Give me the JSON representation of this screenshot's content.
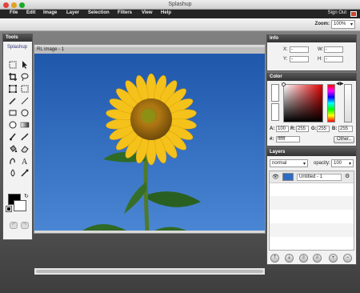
{
  "window": {
    "title": "Splashup"
  },
  "menu": {
    "items": [
      "File",
      "Edit",
      "Image",
      "Layer",
      "Selection",
      "Filters",
      "View",
      "Help"
    ],
    "sign_out": "Sign Out"
  },
  "toolbar": {
    "zoom_label": "Zoom:",
    "zoom_value": "100%"
  },
  "tools": {
    "title": "Tools",
    "logo": "Splashup"
  },
  "canvas": {
    "title": "RL image - 1"
  },
  "info": {
    "title": "Info",
    "x_label": "X:",
    "y_label": "Y:",
    "w_label": "W:",
    "h_label": "H:",
    "x_value": "-",
    "y_value": "-",
    "w_value": "-",
    "h_value": "-"
  },
  "color": {
    "title": "Color",
    "a_label": "A:",
    "a_value": "100",
    "r_label": "R:",
    "r_value": "255",
    "g_label": "G:",
    "g_value": "255",
    "b_label": "B:",
    "b_value": "255",
    "hex_label": "#:",
    "hex_value": "ffffff",
    "other_button": "Other.."
  },
  "layers": {
    "title": "Layers",
    "blend_mode": "normal",
    "opacity_label": "opacity:",
    "opacity_value": "100",
    "items": [
      {
        "name": "Untitled - 1"
      }
    ]
  },
  "colors": {
    "menu_bg": "#252525",
    "panel_head": "#333333",
    "sky": "#2f6cc1",
    "petal": "#f4c21a",
    "center": "#9a6a10",
    "leaf": "#2f6a26"
  }
}
